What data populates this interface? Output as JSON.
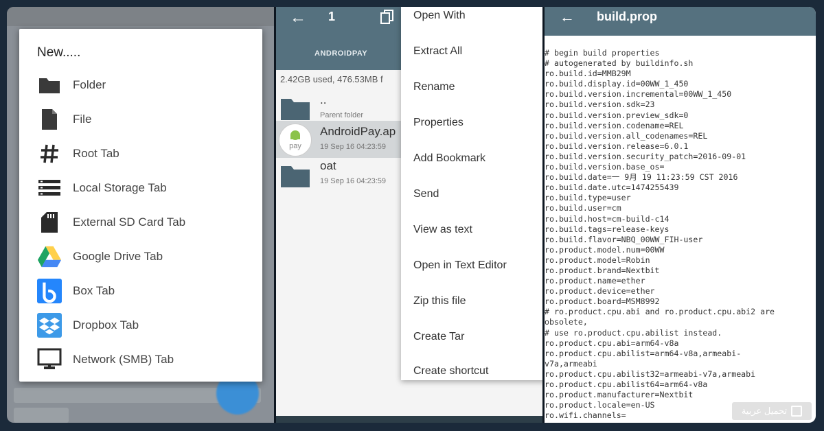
{
  "left_panel": {
    "dialog_title": "New.....",
    "items": [
      {
        "label": "Folder",
        "icon": "folder-icon"
      },
      {
        "label": "File",
        "icon": "file-icon"
      },
      {
        "label": "Root Tab",
        "icon": "hash-icon"
      },
      {
        "label": "Local Storage Tab",
        "icon": "storage-list-icon"
      },
      {
        "label": "External SD Card Tab",
        "icon": "sd-card-icon"
      },
      {
        "label": "Google Drive Tab",
        "icon": "google-drive-icon"
      },
      {
        "label": "Box Tab",
        "icon": "box-icon"
      },
      {
        "label": "Dropbox Tab",
        "icon": "dropbox-icon"
      },
      {
        "label": "Network (SMB) Tab",
        "icon": "monitor-icon"
      }
    ]
  },
  "middle_panel": {
    "selection_count": "1",
    "tab": "ANDROIDPAY",
    "storage_info": "2.42GB used, 476.53MB f",
    "files": [
      {
        "name": "..",
        "sub": "Parent folder"
      },
      {
        "name": "AndroidPay.ap",
        "sub": "19 Sep 16 04:23:59",
        "icon_text": "pay"
      },
      {
        "name": "oat",
        "sub": "19 Sep 16 04:23:59"
      }
    ],
    "context_menu": [
      "Open With",
      "Extract All",
      "Rename",
      "Properties",
      "Add Bookmark",
      "Send",
      "View as text",
      "Open in Text Editor",
      "Zip this file",
      "Create Tar",
      "Create shortcut"
    ]
  },
  "right_panel": {
    "title": "build.prop",
    "lines": [
      "# begin build properties",
      "# autogenerated by buildinfo.sh",
      "ro.build.id=MMB29M",
      "ro.build.display.id=00WW_1_450",
      "ro.build.version.incremental=00WW_1_450",
      "ro.build.version.sdk=23",
      "ro.build.version.preview_sdk=0",
      "ro.build.version.codename=REL",
      "ro.build.version.all_codenames=REL",
      "ro.build.version.release=6.0.1",
      "ro.build.version.security_patch=2016-09-01",
      "ro.build.version.base_os=",
      "ro.build.date=一 9月 19 11:23:59 CST 2016",
      "ro.build.date.utc=1474255439",
      "ro.build.type=user",
      "ro.build.user=cm",
      "ro.build.host=cm-build-c14",
      "ro.build.tags=release-keys",
      "ro.build.flavor=NBQ_00WW_FIH-user",
      "ro.product.model.num=00WW",
      "ro.product.model=Robin",
      "ro.product.brand=Nextbit",
      "ro.product.name=ether",
      "ro.product.device=ether",
      "ro.product.board=MSM8992",
      "# ro.product.cpu.abi and ro.product.cpu.abi2 are",
      "obsolete,",
      "# use ro.product.cpu.abilist instead.",
      "ro.product.cpu.abi=arm64-v8a",
      "ro.product.cpu.abilist=arm64-v8a,armeabi-",
      "v7a,armeabi",
      "ro.product.cpu.abilist32=armeabi-v7a,armeabi",
      "ro.product.cpu.abilist64=arm64-v8a",
      "ro.product.manufacturer=Nextbit",
      "ro.product.locale=en-US",
      "ro.wifi.channels="
    ]
  },
  "watermark": "تحميل عربية",
  "colors": {
    "toolbar": "#55717f",
    "folder": "#4b6573",
    "drive_green": "#1fa463",
    "drive_yellow": "#ffd04b",
    "drive_blue": "#4688f4",
    "box_blue": "#2486fc",
    "dropbox_blue": "#3d9ae8",
    "fab": "#3b8fd6"
  }
}
